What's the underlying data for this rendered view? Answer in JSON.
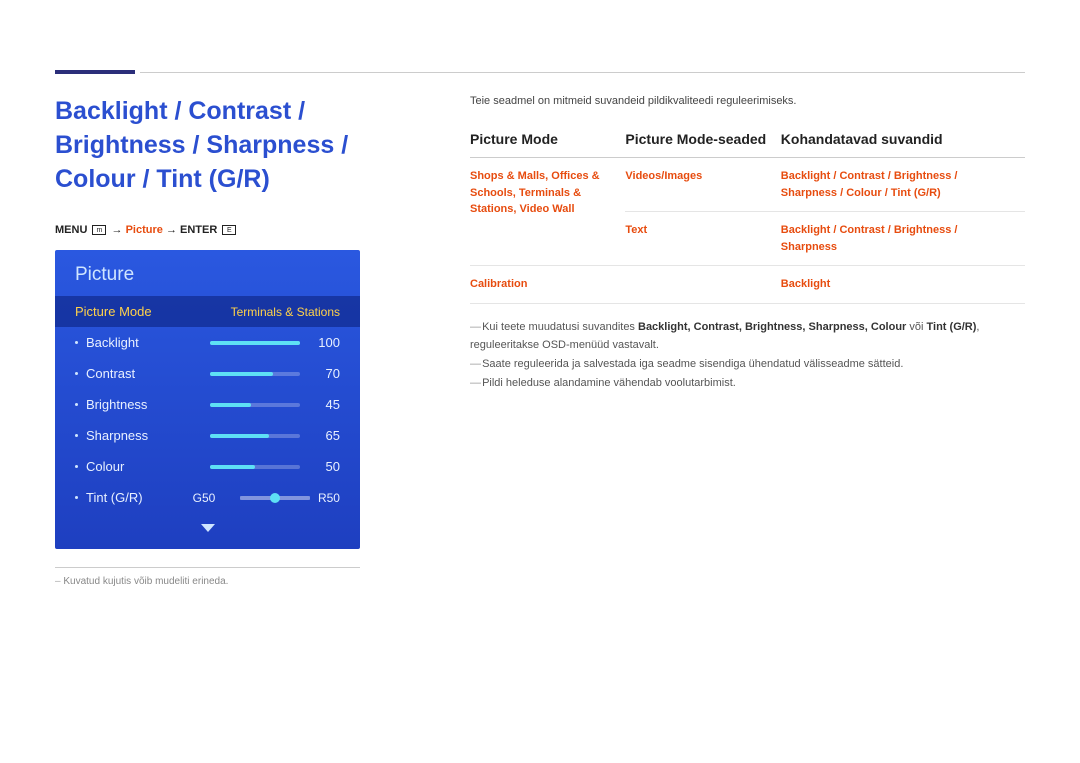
{
  "title": "Backlight / Contrast / Brightness / Sharpness / Colour / Tint (G/R)",
  "menupath": {
    "menu": "MENU",
    "picture": "Picture",
    "enter": "ENTER",
    "arrow": "→"
  },
  "osd": {
    "header": "Picture",
    "mode_label": "Picture Mode",
    "mode_value": "Terminals & Stations",
    "rows": [
      {
        "label": "Backlight",
        "value": 100,
        "pct": 100
      },
      {
        "label": "Contrast",
        "value": 70,
        "pct": 70
      },
      {
        "label": "Brightness",
        "value": 45,
        "pct": 45
      },
      {
        "label": "Sharpness",
        "value": 65,
        "pct": 65
      },
      {
        "label": "Colour",
        "value": 50,
        "pct": 50
      }
    ],
    "tint": {
      "label": "Tint (G/R)",
      "left": "G50",
      "right": "R50",
      "pos": 50
    }
  },
  "footnote": "Kuvatud kujutis võib mudeliti erineda.",
  "intro": "Teie seadmel on mitmeid suvandeid pildikvaliteedi reguleerimiseks.",
  "table": {
    "headers": [
      "Picture Mode",
      "Picture Mode-seaded",
      "Kohandatavad suvandid"
    ],
    "rows": [
      {
        "c1": "Shops & Malls, Offices & Schools, Terminals & Stations, Video Wall",
        "c2": "Videos/Images",
        "c3": "Backlight / Contrast / Brightness / Sharpness / Colour / Tint (G/R)"
      },
      {
        "c1": "",
        "c2": "Text",
        "c3": "Backlight / Contrast / Brightness / Sharpness"
      },
      {
        "c1": "Calibration",
        "c2": "",
        "c3": "Backlight"
      }
    ]
  },
  "notes": [
    {
      "pre": "Kui teete muudatusi suvandites ",
      "bold": "Backlight, Contrast, Brightness, Sharpness, Colour",
      "mid": " või ",
      "bold2": "Tint (G/R)",
      "post": ", reguleeritakse OSD-menüüd vastavalt."
    },
    {
      "text": "Saate reguleerida ja salvestada iga seadme sisendiga ühendatud välisseadme sätteid."
    },
    {
      "text": "Pildi heleduse alandamine vähendab voolutarbimist."
    }
  ]
}
